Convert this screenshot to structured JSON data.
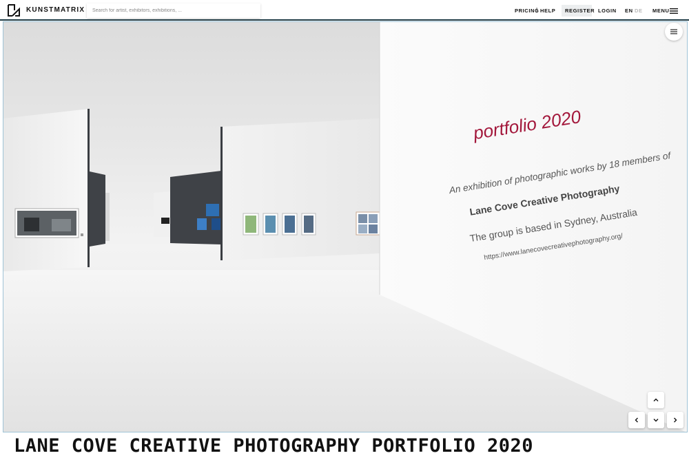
{
  "header": {
    "brand": "KUNSTMATRIX",
    "search_placeholder": "Search for artist, exhibitors, exhibitions, ...",
    "pricing": "PRICING",
    "separator": "|",
    "help": "HELP",
    "register": "REGISTER",
    "login": "LOGIN",
    "lang_en": "EN",
    "lang_de": "DE",
    "menu": "MENU"
  },
  "exhibit": {
    "wall_title": "portfolio 2020",
    "line1": "An exhibition of photographic works by 18 members of",
    "line2": "Lane Cove Creative Photography",
    "line3": "The group is based in Sydney, Australia",
    "line4": "https://www.lanecovecreativephotography.org/"
  },
  "controls": {
    "side_menu_icon": "hamburger-icon",
    "up_icon": "chevron-up-icon",
    "left_icon": "chevron-left-icon",
    "down_icon": "chevron-down-icon",
    "right_icon": "chevron-right-icon"
  },
  "page_title": "LANE COVE CREATIVE PHOTOGRAPHY PORTFOLIO 2020",
  "colors": {
    "header_border": "#1f3b45",
    "accent_text": "#a3183c",
    "wall_text": "#555555",
    "dark_wall": "#3f4247"
  }
}
